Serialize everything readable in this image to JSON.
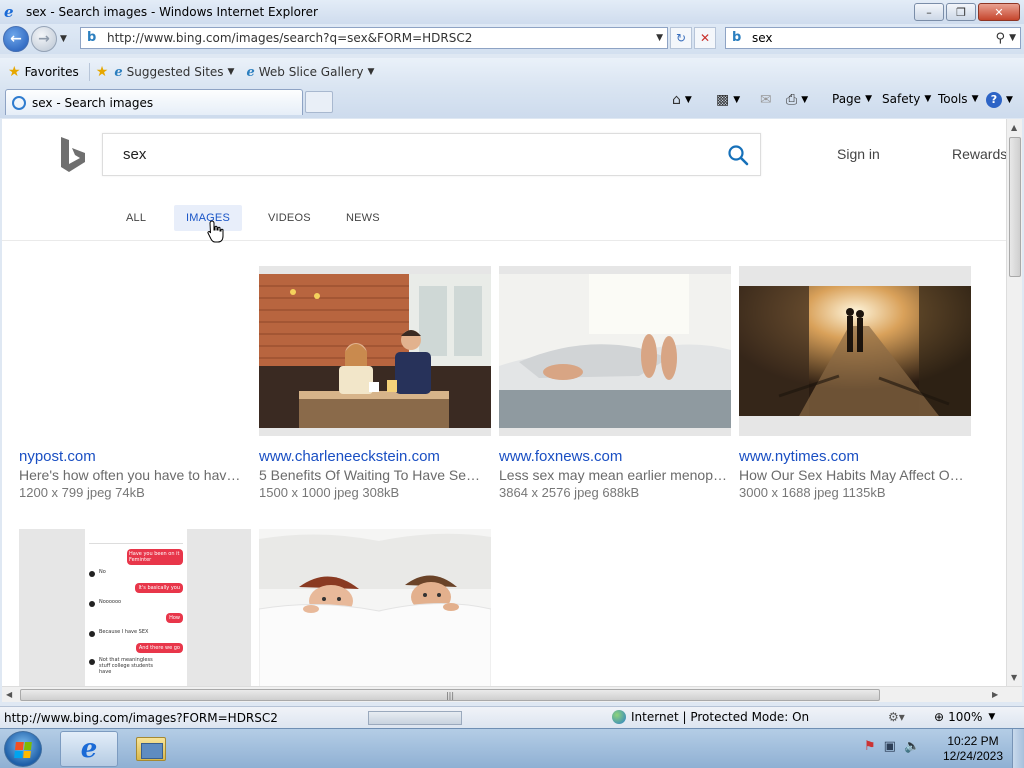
{
  "window": {
    "title": "sex - Search images - Windows Internet Explorer",
    "minimize_label": "–",
    "maximize_label": "❐",
    "close_label": "✕"
  },
  "address_bar": {
    "url": "http://www.bing.com/images/search?q=sex&FORM=HDRSC2",
    "search_query": "sex"
  },
  "favorites_bar": {
    "favorites_label": "Favorites",
    "items": [
      {
        "label": "Suggested Sites"
      },
      {
        "label": "Web Slice Gallery"
      }
    ]
  },
  "tabs": [
    {
      "label": "sex - Search images"
    }
  ],
  "command_bar": {
    "page_label": "Page",
    "safety_label": "Safety",
    "tools_label": "Tools"
  },
  "bing": {
    "query": "sex",
    "sign_in": "Sign in",
    "rewards": "Rewards",
    "brand_color": "#00809d",
    "nav_tabs": [
      {
        "label": "ALL",
        "active": false
      },
      {
        "label": "IMAGES",
        "active": true
      },
      {
        "label": "VIDEOS",
        "active": false
      },
      {
        "label": "NEWS",
        "active": false
      }
    ]
  },
  "results": [
    {
      "site": "nypost.com",
      "desc": "Here's how often you have to hav…",
      "meta": "1200 x 799 jpeg 74kB",
      "image": "blank"
    },
    {
      "site": "www.charleneeckstein.com",
      "desc": "5 Benefits Of Waiting To Have Se…",
      "meta": "1500 x 1000 jpeg 308kB",
      "image": "couple-cafe"
    },
    {
      "site": "www.foxnews.com",
      "desc": "Less sex may mean earlier menop…",
      "meta": "3864 x 2576 jpeg 688kB",
      "image": "feet-bed"
    },
    {
      "site": "www.nytimes.com",
      "desc": "How Our Sex Habits May Affect O…",
      "meta": "3000 x 1688 jpeg 1135kB",
      "image": "couple-alley"
    },
    {
      "site": "",
      "desc": "",
      "meta": "",
      "image": "phone-chat"
    },
    {
      "site": "",
      "desc": "",
      "meta": "",
      "image": "couple-bed"
    }
  ],
  "phone_chat_messages": [
    "Have you been on it Feminter",
    "No",
    "It's basically you",
    "Noooooo",
    "How",
    "Because I have SEX",
    "And there we go",
    "Not that meaningless stuff college students have"
  ],
  "status_bar": {
    "url": "http://www.bing.com/images?FORM=HDRSC2",
    "zone": "Internet | Protected Mode: On",
    "zoom": "100%"
  },
  "taskbar": {
    "time": "10:22 PM",
    "date": "12/24/2023"
  }
}
